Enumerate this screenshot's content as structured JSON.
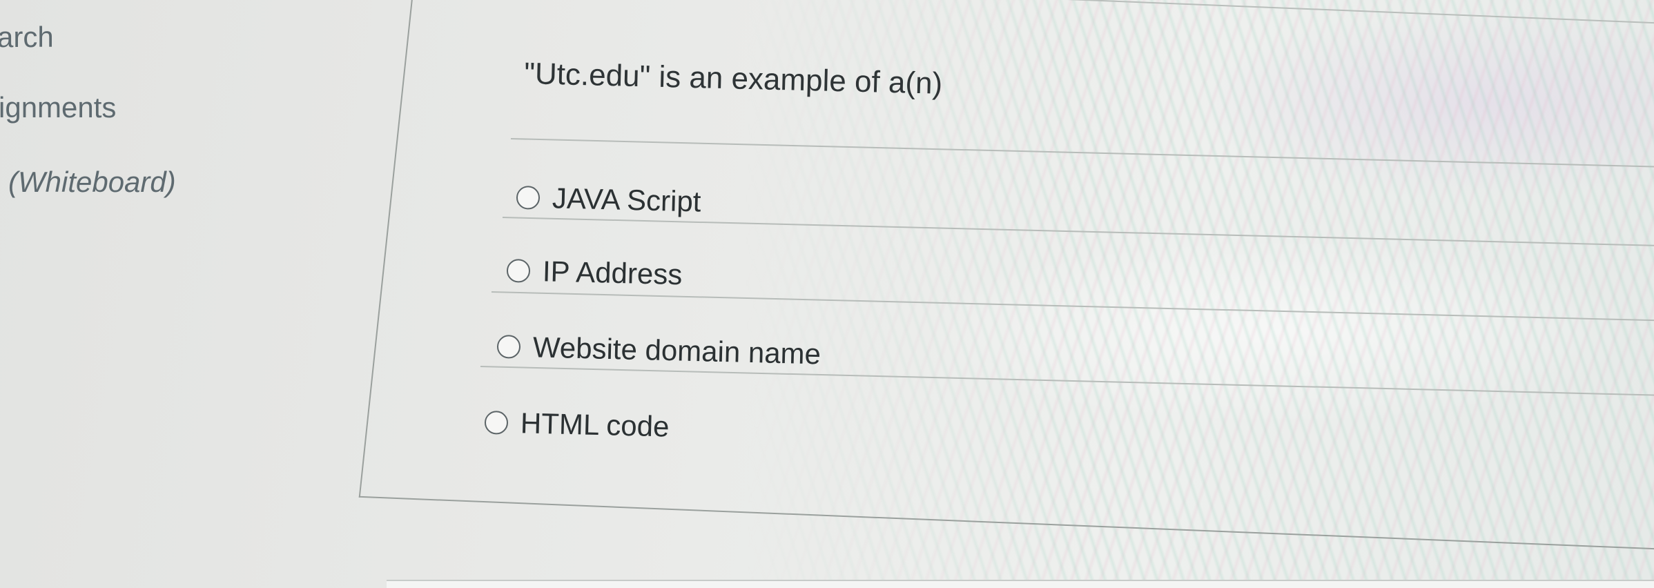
{
  "sidebar": {
    "items": [
      {
        "label": "arch"
      },
      {
        "label": "ignments"
      },
      {
        "label": "(Whiteboard)"
      }
    ]
  },
  "quiz": {
    "question": "\"Utc.edu\" is an example of a(n)",
    "options": [
      {
        "label": "JAVA Script"
      },
      {
        "label": "IP Address"
      },
      {
        "label": "Website domain name"
      },
      {
        "label": "HTML code"
      }
    ]
  },
  "colors": {
    "text": "#2e3436",
    "sidebar_text": "#5e6a70",
    "rule": "#b7bcb9",
    "radio_border": "#5c6467"
  },
  "icons": {
    "option_marker": "radio-unselected-icon"
  }
}
